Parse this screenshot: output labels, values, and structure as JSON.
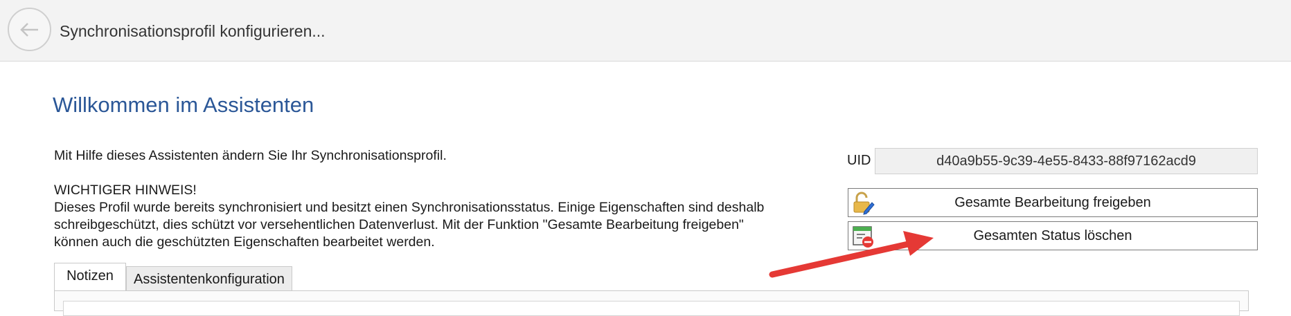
{
  "header": {
    "window_title": "Synchronisationsprofil konfigurieren...",
    "back_icon": "arrow-left-icon"
  },
  "main": {
    "title": "Willkommen im Assistenten",
    "intro": "Mit Hilfe dieses Assistenten ändern Sie Ihr Synchronisationsprofil.",
    "notice_heading": "WICHTIGER HINWEIS!",
    "notice_lines": [
      "Dieses Profil wurde bereits synchronisiert und besitzt einen Synchronisationsstatus. Einige Eigenschaften sind deshalb",
      "schreibgeschützt, dies schützt vor versehentlichen Datenverlust. Mit der Funktion \"Gesamte Bearbeitung freigeben\"",
      "können auch die geschützten Eigenschaften bearbeitet werden."
    ]
  },
  "uid": {
    "label": "UID",
    "value": "d40a9b55-9c39-4e55-8433-88f97162acd9"
  },
  "actions": {
    "release_label": "Gesamte Bearbeitung freigeben",
    "release_icon": "unlock-edit-icon",
    "clear_label": "Gesamten Status löschen",
    "clear_icon": "delete-status-icon"
  },
  "tabs": [
    {
      "label": "Notizen",
      "active": true
    },
    {
      "label": "Assistentenkonfiguration",
      "active": false
    }
  ],
  "colors": {
    "title_blue": "#2b5797",
    "arrow_red": "#e53935"
  }
}
